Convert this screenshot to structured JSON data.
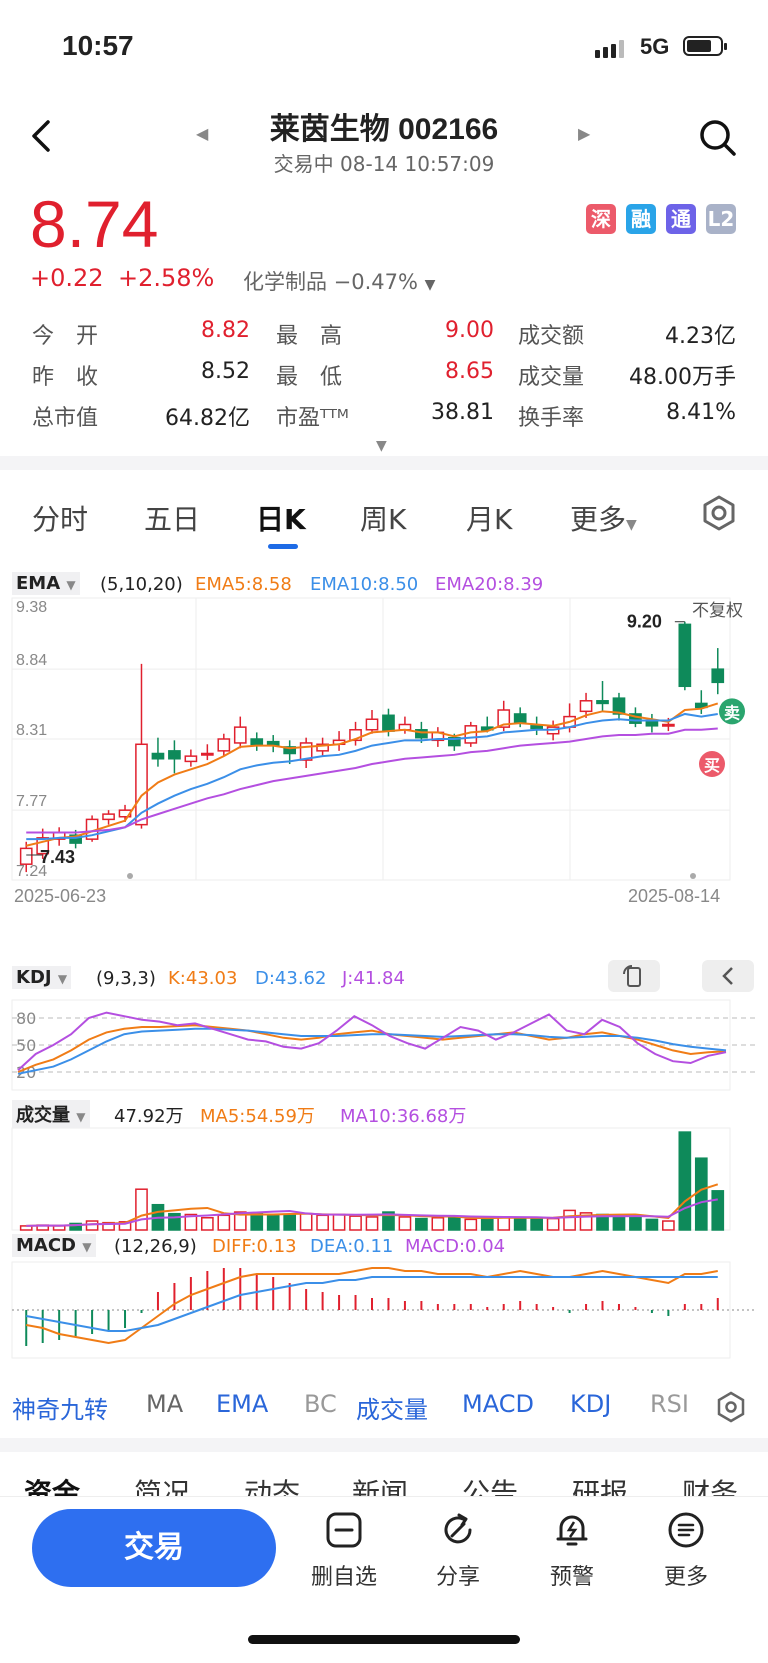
{
  "status": {
    "time": "10:57",
    "network": "5G"
  },
  "header": {
    "title": "莱茵生物 002166",
    "subtitle": "交易中 08-14 10:57:09"
  },
  "quote": {
    "price": "8.74",
    "change": "+0.22",
    "change_pct": "+2.58%",
    "industry": "化学制品 −0.47%",
    "badges": [
      "深",
      "融",
      "通",
      "L2"
    ],
    "stats": [
      {
        "label": "今　开",
        "value": "8.82"
      },
      {
        "label": "最　高",
        "value": "9.00"
      },
      {
        "label": "成交额",
        "value": "4.23亿"
      },
      {
        "label": "昨　收",
        "value": "8.52"
      },
      {
        "label": "最　低",
        "value": "8.65"
      },
      {
        "label": "成交量",
        "value": "48.00万手"
      },
      {
        "label": "总市值",
        "value": "64.82亿"
      },
      {
        "label": "市盈ᵀᵀᴹ",
        "value": "38.81"
      },
      {
        "label": "换手率",
        "value": "8.41%"
      }
    ]
  },
  "period_tabs": [
    "分时",
    "五日",
    "日K",
    "周K",
    "月K",
    "更多"
  ],
  "ema": {
    "name": "EMA",
    "params": "(5,10,20)",
    "e5": "EMA5:8.58",
    "e10": "EMA10:8.50",
    "e20": "EMA20:8.39"
  },
  "kdj": {
    "name": "KDJ",
    "params": "(9,3,3)",
    "k": "K:43.03",
    "d": "D:43.62",
    "j": "J:41.84"
  },
  "vol": {
    "name": "成交量",
    "value": "47.92万",
    "ma5": "MA5:54.59万",
    "ma10": "MA10:36.68万"
  },
  "macd": {
    "name": "MACD",
    "params": "(12,26,9)",
    "diff": "DIFF:0.13",
    "dea": "DEA:0.11",
    "macd": "MACD:0.04"
  },
  "chart_data": {
    "type": "candlestick",
    "y_ticks": [
      "9.38",
      "8.84",
      "8.31",
      "7.77",
      "7.24"
    ],
    "x_labels": [
      "2025-06-23",
      "2025-08-14"
    ],
    "annotations": {
      "high": "9.20",
      "low": "7.43",
      "fq": "不复权",
      "sell": "卖",
      "buy": "买"
    },
    "kdj_ticks": [
      "80",
      "50",
      "20"
    ],
    "candles": [
      [
        7.36,
        7.48,
        7.53,
        7.3
      ],
      [
        7.44,
        7.56,
        7.63,
        7.4
      ],
      [
        7.55,
        7.6,
        7.64,
        7.5
      ],
      [
        7.58,
        7.52,
        7.62,
        7.48
      ],
      [
        7.55,
        7.7,
        7.73,
        7.53
      ],
      [
        7.7,
        7.74,
        7.77,
        7.66
      ],
      [
        7.72,
        7.77,
        7.81,
        7.68
      ],
      [
        7.66,
        8.27,
        8.88,
        7.63
      ],
      [
        8.2,
        8.16,
        8.32,
        8.1
      ],
      [
        8.22,
        8.16,
        8.3,
        8.05
      ],
      [
        8.14,
        8.18,
        8.23,
        8.1
      ],
      [
        8.19,
        8.2,
        8.27,
        8.15
      ],
      [
        8.22,
        8.31,
        8.35,
        8.18
      ],
      [
        8.28,
        8.4,
        8.48,
        8.24
      ],
      [
        8.31,
        8.27,
        8.36,
        8.22
      ],
      [
        8.29,
        8.26,
        8.34,
        8.21
      ],
      [
        8.25,
        8.2,
        8.3,
        8.12
      ],
      [
        8.15,
        8.28,
        8.32,
        8.09
      ],
      [
        8.22,
        8.27,
        8.32,
        8.18
      ],
      [
        8.27,
        8.3,
        8.37,
        8.22
      ],
      [
        8.3,
        8.38,
        8.44,
        8.26
      ],
      [
        8.38,
        8.46,
        8.53,
        8.35
      ],
      [
        8.49,
        8.37,
        8.54,
        8.33
      ],
      [
        8.38,
        8.42,
        8.48,
        8.35
      ],
      [
        8.38,
        8.32,
        8.44,
        8.28
      ],
      [
        8.3,
        8.36,
        8.4,
        8.25
      ],
      [
        8.32,
        8.26,
        8.35,
        8.22
      ],
      [
        8.28,
        8.41,
        8.44,
        8.25
      ],
      [
        8.4,
        8.38,
        8.48,
        8.36
      ],
      [
        8.4,
        8.53,
        8.6,
        8.37
      ],
      [
        8.5,
        8.43,
        8.55,
        8.4
      ],
      [
        8.41,
        8.39,
        8.48,
        8.34
      ],
      [
        8.35,
        8.4,
        8.45,
        8.3
      ],
      [
        8.4,
        8.48,
        8.58,
        8.36
      ],
      [
        8.52,
        8.6,
        8.66,
        8.47
      ],
      [
        8.6,
        8.58,
        8.75,
        8.52
      ],
      [
        8.62,
        8.5,
        8.66,
        8.45
      ],
      [
        8.5,
        8.43,
        8.55,
        8.4
      ],
      [
        8.45,
        8.41,
        8.5,
        8.36
      ],
      [
        8.41,
        8.42,
        8.47,
        8.37
      ],
      [
        9.18,
        8.71,
        9.2,
        8.68
      ],
      [
        8.58,
        8.55,
        8.68,
        8.5
      ],
      [
        8.84,
        8.74,
        9.0,
        8.65
      ]
    ],
    "volume": [
      5,
      6,
      5,
      8,
      11,
      9,
      10,
      50,
      31,
      20,
      19,
      15,
      18,
      22,
      21,
      19,
      18,
      20,
      18,
      19,
      17,
      16,
      22,
      16,
      14,
      15,
      16,
      13,
      15,
      16,
      15,
      15,
      14,
      24,
      21,
      19,
      16,
      15,
      13,
      11,
      120,
      88,
      48
    ],
    "kdj_k": [
      20,
      28,
      34,
      44,
      56,
      64,
      68,
      70,
      70,
      71,
      72,
      70,
      68,
      66,
      62,
      58,
      56,
      58,
      62,
      64,
      66,
      62,
      60,
      58,
      56,
      58,
      60,
      62,
      64,
      60,
      56,
      58,
      62,
      64,
      60,
      56,
      50,
      44,
      40,
      42,
      43
    ],
    "kdj_d": [
      18,
      22,
      26,
      34,
      44,
      54,
      62,
      65,
      66,
      67,
      68,
      68,
      67,
      66,
      64,
      62,
      60,
      60,
      60,
      61,
      62,
      62,
      61,
      60,
      59,
      60,
      61,
      62,
      62,
      61,
      59,
      58,
      59,
      60,
      60,
      58,
      55,
      51,
      48,
      46,
      44
    ],
    "kdj_j": [
      22,
      40,
      50,
      62,
      80,
      86,
      82,
      78,
      76,
      72,
      74,
      68,
      62,
      56,
      54,
      48,
      46,
      52,
      66,
      82,
      72,
      60,
      52,
      46,
      58,
      70,
      66,
      56,
      64,
      74,
      84,
      66,
      62,
      78,
      70,
      52,
      40,
      32,
      30,
      38,
      42
    ],
    "macd_diff": [
      -0.05,
      -0.06,
      -0.08,
      -0.09,
      -0.1,
      -0.11,
      -0.1,
      -0.06,
      -0.02,
      0.02,
      0.05,
      0.07,
      0.09,
      0.11,
      0.12,
      0.12,
      0.12,
      0.12,
      0.12,
      0.12,
      0.13,
      0.14,
      0.14,
      0.13,
      0.13,
      0.12,
      0.12,
      0.12,
      0.11,
      0.12,
      0.13,
      0.12,
      0.11,
      0.11,
      0.12,
      0.13,
      0.12,
      0.11,
      0.1,
      0.09,
      0.12,
      0.12,
      0.13
    ],
    "macd_dea": [
      -0.02,
      -0.03,
      -0.04,
      -0.05,
      -0.06,
      -0.07,
      -0.07,
      -0.06,
      -0.05,
      -0.03,
      -0.01,
      0.01,
      0.03,
      0.05,
      0.06,
      0.07,
      0.08,
      0.09,
      0.09,
      0.1,
      0.1,
      0.11,
      0.11,
      0.11,
      0.11,
      0.11,
      0.11,
      0.11,
      0.11,
      0.11,
      0.11,
      0.11,
      0.11,
      0.11,
      0.11,
      0.11,
      0.11,
      0.11,
      0.11,
      0.11,
      0.11,
      0.11,
      0.11
    ],
    "macd_hist": [
      -0.12,
      -0.11,
      -0.1,
      -0.09,
      -0.08,
      -0.07,
      -0.06,
      -0.01,
      0.06,
      0.09,
      0.11,
      0.13,
      0.14,
      0.14,
      0.12,
      0.11,
      0.09,
      0.07,
      0.06,
      0.05,
      0.05,
      0.04,
      0.04,
      0.03,
      0.03,
      0.02,
      0.02,
      0.02,
      0.01,
      0.02,
      0.03,
      0.02,
      0.01,
      -0.01,
      0.02,
      0.03,
      0.02,
      0.01,
      -0.01,
      -0.02,
      0.02,
      0.02,
      0.04
    ],
    "ema5": [
      7.5,
      7.53,
      7.56,
      7.57,
      7.61,
      7.65,
      7.69,
      7.88,
      7.98,
      8.04,
      8.08,
      8.12,
      8.18,
      8.25,
      8.26,
      8.26,
      8.24,
      8.25,
      8.26,
      8.27,
      8.31,
      8.36,
      8.37,
      8.38,
      8.36,
      8.36,
      8.33,
      8.36,
      8.37,
      8.42,
      8.43,
      8.42,
      8.41,
      8.44,
      8.49,
      8.52,
      8.51,
      8.48,
      8.46,
      8.44,
      8.53,
      8.54,
      8.58
    ],
    "ema10": [
      7.55,
      7.55,
      7.56,
      7.56,
      7.58,
      7.61,
      7.64,
      7.75,
      7.82,
      7.88,
      7.93,
      7.97,
      8.02,
      8.08,
      8.11,
      8.13,
      8.14,
      8.16,
      8.18,
      8.19,
      8.22,
      8.26,
      8.28,
      8.3,
      8.3,
      8.31,
      8.31,
      8.32,
      8.33,
      8.36,
      8.37,
      8.38,
      8.38,
      8.4,
      8.43,
      8.45,
      8.46,
      8.45,
      8.45,
      8.45,
      8.5,
      8.48,
      8.5
    ],
    "ema20": [
      7.6,
      7.6,
      7.6,
      7.6,
      7.61,
      7.62,
      7.64,
      7.7,
      7.74,
      7.78,
      7.82,
      7.86,
      7.89,
      7.93,
      7.96,
      7.99,
      8.01,
      8.03,
      8.05,
      8.07,
      8.09,
      8.12,
      8.14,
      8.16,
      8.17,
      8.18,
      8.19,
      8.21,
      8.22,
      8.24,
      8.26,
      8.27,
      8.28,
      8.29,
      8.31,
      8.33,
      8.34,
      8.34,
      8.35,
      8.35,
      8.38,
      8.38,
      8.39
    ]
  },
  "indicator_tabs": [
    "神奇九转",
    "MA",
    "EMA",
    "BC",
    "成交量",
    "MACD",
    "KDJ",
    "RSI"
  ],
  "section_tabs": [
    "资金",
    "简况",
    "动态",
    "新闻",
    "公告",
    "研报",
    "财务"
  ],
  "bottom": {
    "trade": "交易",
    "items": [
      "删自选",
      "分享",
      "预警",
      "更多"
    ]
  }
}
